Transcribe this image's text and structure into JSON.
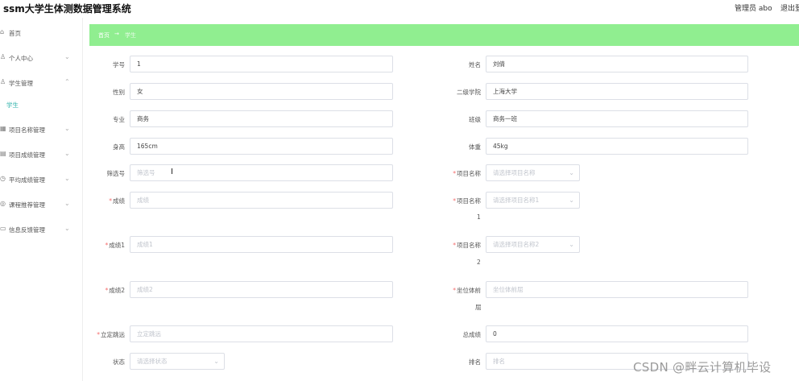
{
  "header": {
    "title": "ssm大学生体测数据管理系统",
    "admin": "管理员 abo",
    "logout": "退出登"
  },
  "sidebar": {
    "items": [
      {
        "label": "首页",
        "icon": "home-icon",
        "chevron": ""
      },
      {
        "label": "个人中心",
        "icon": "user-icon",
        "chevron": "⌄"
      },
      {
        "label": "学生管理",
        "icon": "user-icon",
        "chevron": "⌃"
      },
      {
        "label": "项目名称管理",
        "icon": "grid-icon",
        "chevron": "⌄"
      },
      {
        "label": "项目成绩管理",
        "icon": "list-icon",
        "chevron": "⌄"
      },
      {
        "label": "平均成绩管理",
        "icon": "clock-icon",
        "chevron": "⌄"
      },
      {
        "label": "课程推荐管理",
        "icon": "circle-icon",
        "chevron": "⌄"
      },
      {
        "label": "信息反馈管理",
        "icon": "chat-icon",
        "chevron": "⌄"
      }
    ],
    "sub_item": "学生"
  },
  "breadcrumb": {
    "home": "首页",
    "arrow": "→",
    "current": "学生"
  },
  "form": {
    "student_no": {
      "label": "学号",
      "value": "1"
    },
    "name": {
      "label": "姓名",
      "value": "刘倩"
    },
    "gender": {
      "label": "性别",
      "value": "女"
    },
    "college": {
      "label": "二级学院",
      "value": "上海大学"
    },
    "major": {
      "label": "专业",
      "value": "商务"
    },
    "class": {
      "label": "班级",
      "value": "商务一班"
    },
    "height": {
      "label": "身高",
      "value": "165cm"
    },
    "weight": {
      "label": "体重",
      "value": "45kg"
    },
    "screening": {
      "label": "筛选号",
      "placeholder": "筛选号"
    },
    "project_name": {
      "label": "项目名称",
      "placeholder": "请选择项目名称"
    },
    "score": {
      "label": "成绩",
      "placeholder": "成绩"
    },
    "project_name1": {
      "label": "项目名称",
      "label_tail": "1",
      "placeholder": "请选择项目名称1"
    },
    "score1": {
      "label": "成绩1",
      "placeholder": "成绩1"
    },
    "project_name2": {
      "label": "项目名称",
      "label_tail": "2",
      "placeholder": "请选择项目名称2"
    },
    "score2": {
      "label": "成绩2",
      "placeholder": "成绩2"
    },
    "sit_forward": {
      "label": "坐位体前",
      "label_tail": "屈",
      "placeholder": "坐位体前屈"
    },
    "standing_jump": {
      "label": "立定跳远",
      "placeholder": "立定跳远"
    },
    "total_score": {
      "label": "总成绩",
      "value": "0"
    },
    "status": {
      "label": "状态",
      "placeholder": "请选择状态"
    },
    "rank": {
      "label": "排名",
      "placeholder": "排名"
    }
  },
  "watermark": "CSDN @畔云计算机毕设"
}
